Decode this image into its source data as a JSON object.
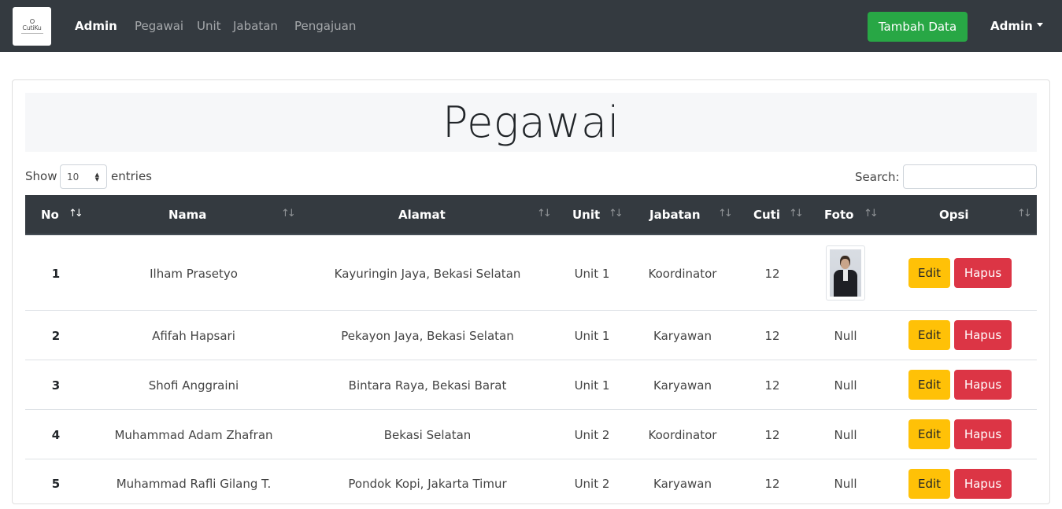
{
  "navbar": {
    "logo_text": "CutiKu",
    "brand": "Admin",
    "links": [
      "Pegawai",
      "Unit",
      "Jabatan",
      "Pengajuan"
    ],
    "add_button": "Tambah Data",
    "user_menu": "Admin"
  },
  "page": {
    "title": "Pegawai"
  },
  "table_controls": {
    "show_label": "Show",
    "length_value": "10",
    "entries_label": "entries",
    "search_label": "Search:",
    "search_value": ""
  },
  "table": {
    "columns": [
      "No",
      "Nama",
      "Alamat",
      "Unit",
      "Jabatan",
      "Cuti",
      "Foto",
      "Opsi"
    ],
    "edit_label": "Edit",
    "delete_label": "Hapus",
    "rows": [
      {
        "no": "1",
        "nama": "Ilham Prasetyo",
        "alamat": "Kayuringin Jaya, Bekasi Selatan",
        "unit": "Unit 1",
        "jabatan": "Koordinator",
        "cuti": "12",
        "foto": ""
      },
      {
        "no": "2",
        "nama": "Afifah Hapsari",
        "alamat": "Pekayon Jaya, Bekasi Selatan",
        "unit": "Unit 1",
        "jabatan": "Karyawan",
        "cuti": "12",
        "foto": "Null"
      },
      {
        "no": "3",
        "nama": "Shofi Anggraini",
        "alamat": "Bintara Raya, Bekasi Barat",
        "unit": "Unit 1",
        "jabatan": "Karyawan",
        "cuti": "12",
        "foto": "Null"
      },
      {
        "no": "4",
        "nama": "Muhammad Adam Zhafran",
        "alamat": "Bekasi Selatan",
        "unit": "Unit 2",
        "jabatan": "Koordinator",
        "cuti": "12",
        "foto": "Null"
      },
      {
        "no": "5",
        "nama": "Muhammad Rafli Gilang T.",
        "alamat": "Pondok Kopi, Jakarta Timur",
        "unit": "Unit 2",
        "jabatan": "Karyawan",
        "cuti": "12",
        "foto": "Null"
      }
    ]
  }
}
